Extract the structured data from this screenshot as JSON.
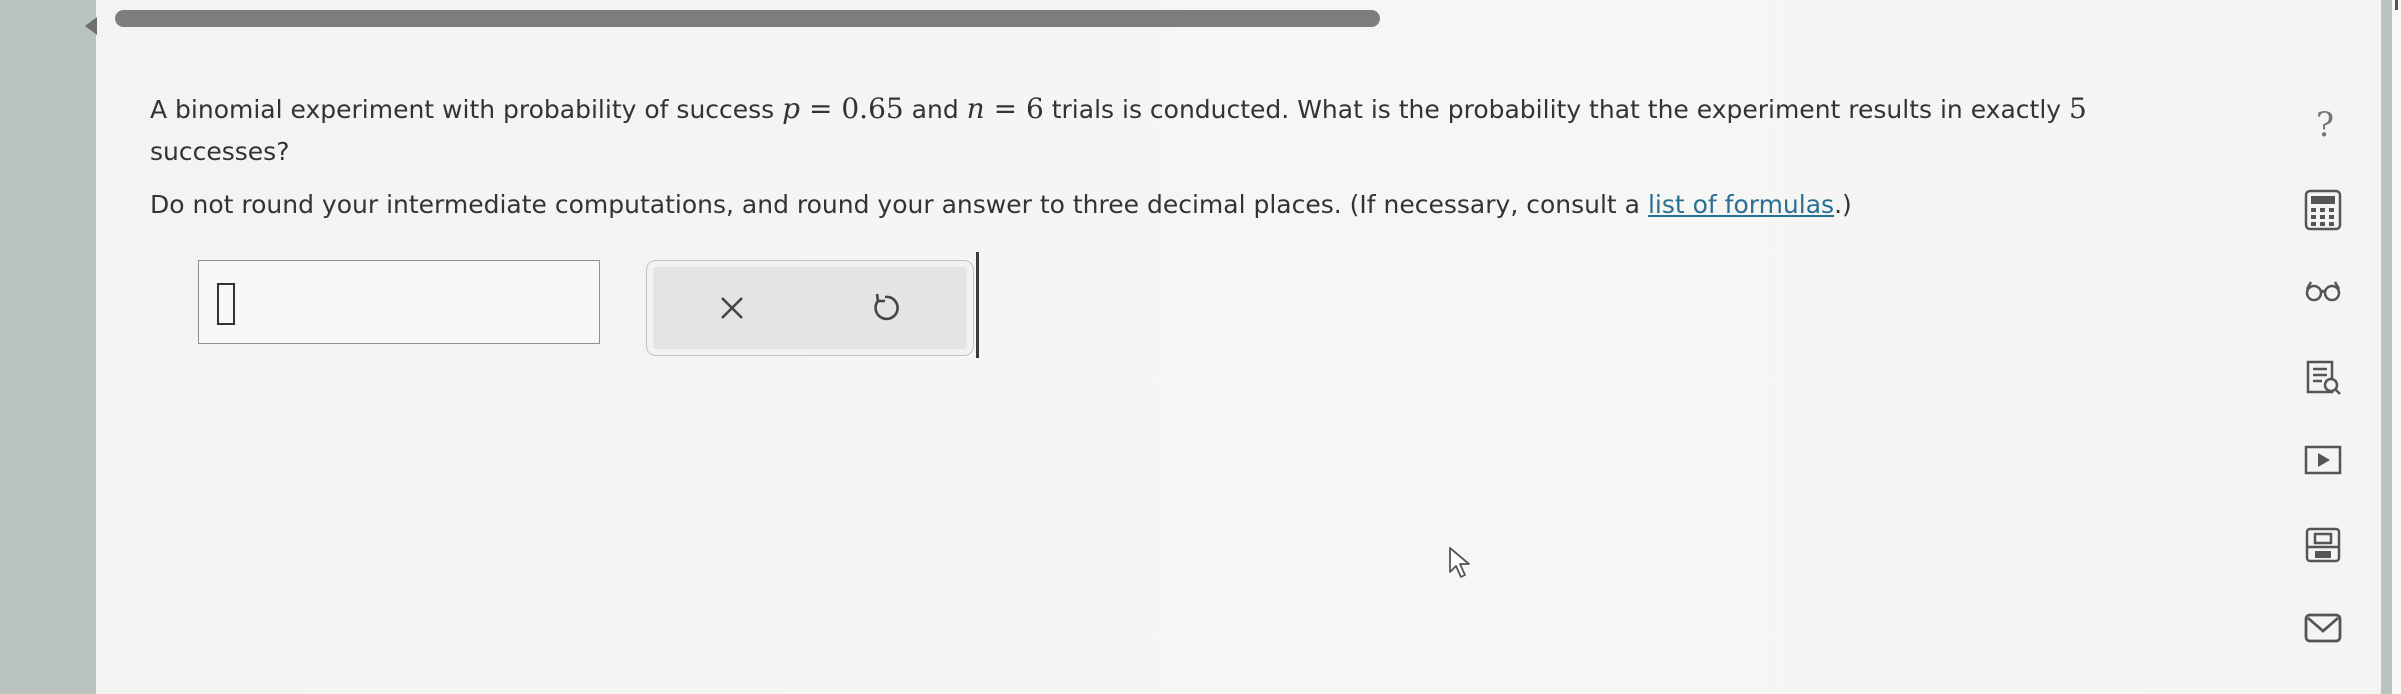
{
  "question": {
    "part1": "A binomial experiment with probability of success ",
    "p_var": "p",
    "eq1": " = ",
    "p_value": "0.65",
    "part2": " and ",
    "n_var": "n",
    "eq2": " = ",
    "n_value": "6",
    "part3": " trials is conducted. What is the probability that the experiment results in exactly ",
    "k_value": "5",
    "part4": " successes?"
  },
  "instructions": {
    "text": "Do not round your intermediate computations, and round your answer to three decimal places. (If necessary, consult a ",
    "link_label": "list of formulas",
    "suffix": ".)"
  },
  "answer": {
    "value": ""
  },
  "buttons": {
    "clear_symbol": "×",
    "undo_symbol": "↺"
  },
  "sidebar": {
    "help_symbol": "?",
    "icons": [
      "calculator-icon",
      "glasses-icon",
      "textbook-icon",
      "video-icon",
      "print-icon",
      "mail-icon"
    ]
  },
  "colors": {
    "link": "#2a6f96",
    "background": "#f4f4f2",
    "frame": "#b9c4c0"
  }
}
